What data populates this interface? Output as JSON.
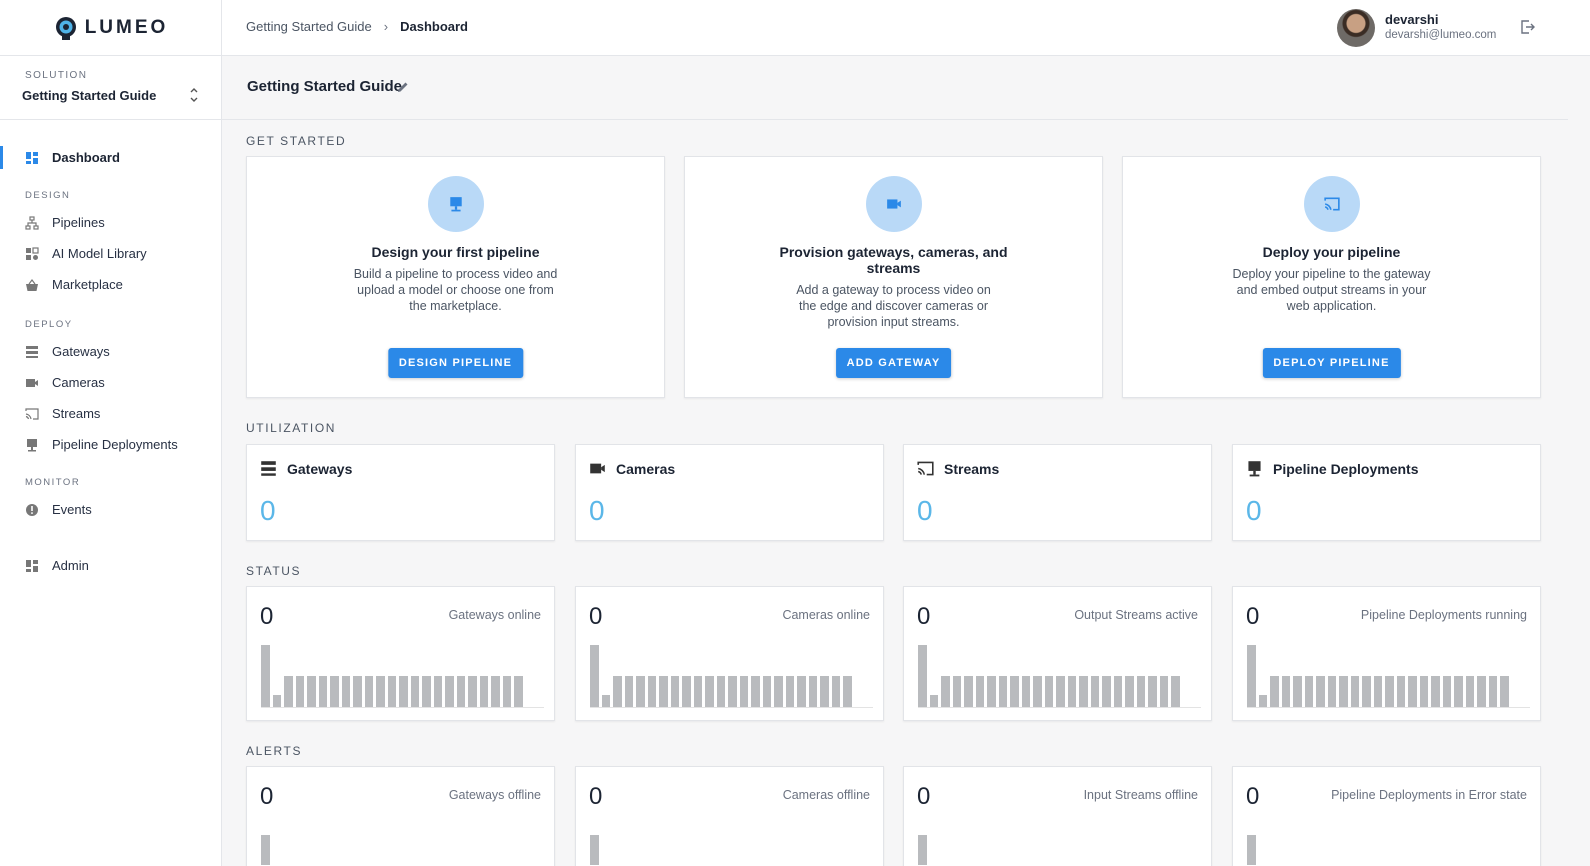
{
  "app": {
    "logo_text": "LUMEO"
  },
  "sidebar": {
    "solution_label": "SOLUTION",
    "solution_value": "Getting Started Guide",
    "dashboard": "Dashboard",
    "sections": {
      "design": "DESIGN",
      "deploy": "DEPLOY",
      "monitor": "MONITOR"
    },
    "items": {
      "pipelines": "Pipelines",
      "ai_model_library": "AI Model Library",
      "marketplace": "Marketplace",
      "gateways": "Gateways",
      "cameras": "Cameras",
      "streams": "Streams",
      "pipeline_deployments": "Pipeline Deployments",
      "events": "Events",
      "admin": "Admin"
    }
  },
  "header": {
    "breadcrumb_parent": "Getting Started Guide",
    "breadcrumb_current": "Dashboard",
    "user_name": "devarshi",
    "user_email": "devarshi@lumeo.com"
  },
  "page": {
    "title": "Getting Started Guide"
  },
  "get_started": {
    "label": "GET STARTED",
    "cards": [
      {
        "title": "Design your first pipeline",
        "desc": "Build a pipeline to process video and upload a model or choose one from the marketplace.",
        "button": "DESIGN PIPELINE",
        "icon": "pipeline-icon"
      },
      {
        "title": "Provision gateways, cameras, and streams",
        "desc": "Add a gateway to process video on the edge and discover cameras or provision input streams.",
        "button": "ADD GATEWAY",
        "icon": "camera-icon"
      },
      {
        "title": "Deploy your pipeline",
        "desc": "Deploy your pipeline to the gateway and embed output streams in your web application.",
        "button": "DEPLOY PIPELINE",
        "icon": "cast-icon"
      }
    ]
  },
  "utilization": {
    "label": "UTILIZATION",
    "cards": [
      {
        "title": "Gateways",
        "value": "0",
        "icon": "gateway-icon"
      },
      {
        "title": "Cameras",
        "value": "0",
        "icon": "camera-icon"
      },
      {
        "title": "Streams",
        "value": "0",
        "icon": "cast-icon"
      },
      {
        "title": "Pipeline Deployments",
        "value": "0",
        "icon": "pipeline-icon"
      }
    ]
  },
  "status": {
    "label": "STATUS",
    "cards": [
      {
        "value": "0",
        "title": "Gateways online"
      },
      {
        "value": "0",
        "title": "Cameras online"
      },
      {
        "value": "0",
        "title": "Output Streams active"
      },
      {
        "value": "0",
        "title": "Pipeline Deployments running"
      }
    ]
  },
  "alerts": {
    "label": "ALERTS",
    "cards": [
      {
        "value": "0",
        "title": "Gateways offline"
      },
      {
        "value": "0",
        "title": "Cameras offline"
      },
      {
        "value": "0",
        "title": "Input Streams offline"
      },
      {
        "value": "0",
        "title": "Pipeline Deployments in Error state"
      }
    ]
  },
  "colors": {
    "accent": "#2b89e8",
    "util_value": "#5bb7e8",
    "icon_circle": "#b9d9f7",
    "bar": "#b9bbbe"
  }
}
